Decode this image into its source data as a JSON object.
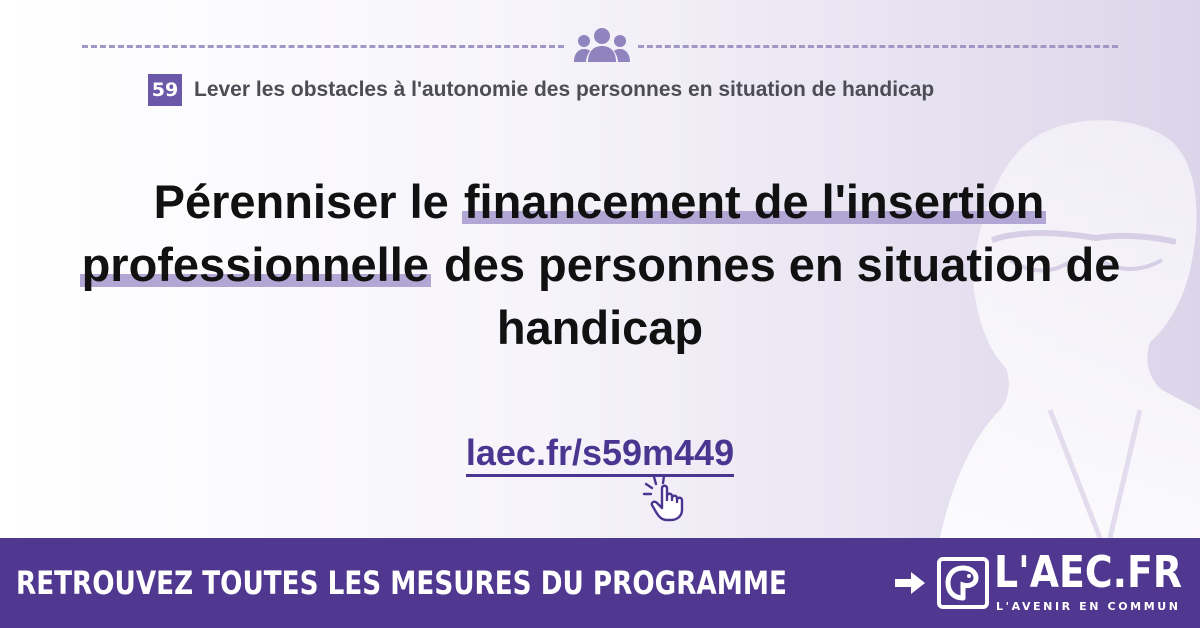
{
  "header": {
    "icon": "people-group-icon",
    "measure_number": "59",
    "measure_title": "Lever les obstacles à l'autonomie des personnes en situation de handicap"
  },
  "headline": {
    "part1": "Pérenniser le ",
    "highlight1": "financement de l'insertion",
    "highlight2": "professionnelle",
    "part2": " des personnes en situation de handicap"
  },
  "link": {
    "text": "laec.fr/s59m449",
    "icon": "pointer-hand-icon"
  },
  "footer": {
    "cta": "RETROUVEZ TOUTES LES MESURES DU PROGRAMME",
    "arrow_icon": "arrow-right-icon",
    "logo_icon": "laec-logo-icon",
    "brand": "L'AEC.FR",
    "tagline": "L'AVENIR EN COMMUN"
  },
  "colors": {
    "accent": "#6b58a8",
    "footer_bg": "#50378f",
    "highlight": "#b2a6d4",
    "link": "#4a3690"
  }
}
